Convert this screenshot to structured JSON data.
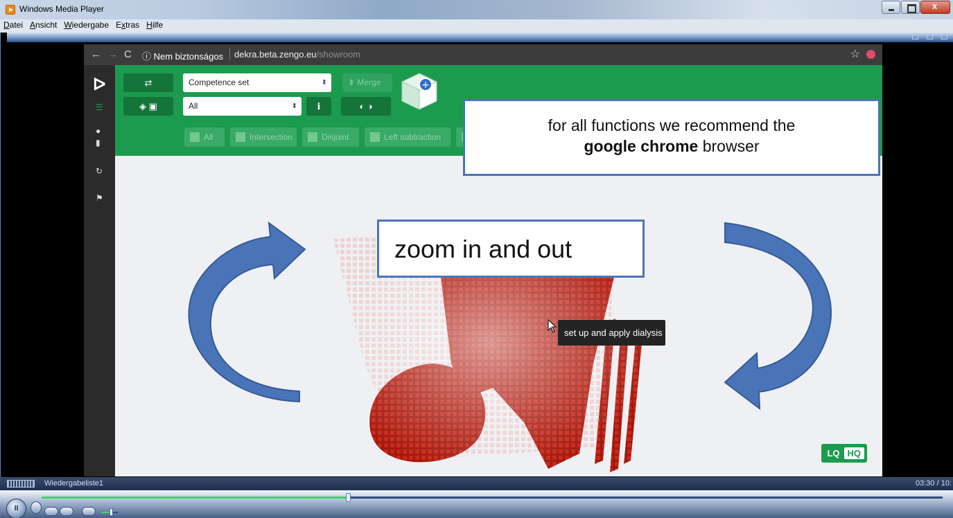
{
  "window": {
    "title": "Windows Media Player"
  },
  "menu": [
    {
      "underline": "D",
      "rest": "atei"
    },
    {
      "underline": "A",
      "rest": "nsicht"
    },
    {
      "underline": "W",
      "rest": "iedergabe"
    },
    {
      "pre": "E",
      "underline": "x",
      "rest": "tras"
    },
    {
      "underline": "H",
      "rest": "ilfe"
    }
  ],
  "browser": {
    "security_label": "ⓘ Nem biztonságos",
    "url_host": "dekra.beta.zengo.eu",
    "url_path": "/showroom"
  },
  "app": {
    "set_select": "Competence set",
    "filter_select": "All",
    "merge_label": "Merge",
    "segments": [
      "All",
      "Intersection",
      "Disjoint",
      "Left subtraction"
    ],
    "lq_label": "LQ",
    "hq_label": "HQ"
  },
  "overlays": {
    "note_line1": "for all functions we recommend the",
    "note_bold": "google chrome",
    "note_rest": " browser",
    "zoom_text": "zoom in and out",
    "tooltip": "set up and apply dialysis"
  },
  "player": {
    "playlist_name": "Wiedergabeliste1",
    "time": "03:30 / 10:",
    "progress_fraction": 0.34,
    "volume_fraction": 0.6
  },
  "colors": {
    "app_green": "#1c9b4f",
    "arrow_blue": "#4a74b8",
    "voxel_red": "#b81c10"
  }
}
